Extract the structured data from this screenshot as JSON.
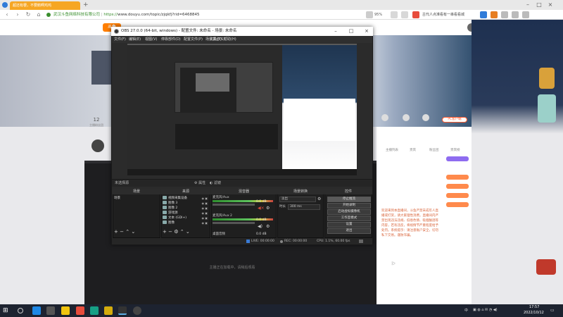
{
  "browser": {
    "tab_title": "超还有梗，不要鹅啊鸡鸡",
    "url_site": "武汉斗鱼网络科技有限公司",
    "url_scheme": "https://",
    "url_rest": "www.douyu.com/topic/zjqkfj?rid=6468845",
    "zoom": "95%",
    "search_text": "古代人点准看有一串看看城"
  },
  "site": {
    "logo": "斗鱼",
    "host_count": "12",
    "host_count_label": "主播粉丝团",
    "pc_button": "PC客户端",
    "tabs": [
      "主播列表",
      "贵宾",
      "粉丝团",
      "贵宾榜"
    ],
    "chat_lines": [
      "欢迎来到本直播间，斗鱼严禁未成年人直",
      "播或打赏，请大家理性消费。直播间内严",
      "禁出现违法违规、低俗色情、吸烟酗酒等",
      "内容，若有违反，将视情节严重程度给予",
      "处罚。系统提示：请注意账户安全，切勿",
      "私下交易。谨防诈骗。"
    ],
    "player_hint": "主播正在加载中，请稍后观看"
  },
  "obs": {
    "title": "OBS 27.0.0 (64-bit, windows) - 配置文件: 未命名 - 场景: 未命名",
    "menu": [
      "文件(F)",
      "编辑(E)",
      "视图(V)",
      "停靠部件(D)",
      "配置文件(P)",
      "场景集合(S)",
      "工具(T)",
      "帮助(H)"
    ],
    "no_source": "未选择源",
    "ctx_props": "属性",
    "ctx_filters": "滤镜",
    "docks": {
      "scenes": "场景",
      "sources": "来源",
      "mixer": "混音器",
      "transitions": "场景转换",
      "controls": "控件"
    },
    "scene_items": [
      "场景"
    ],
    "source_items": [
      "视频采集设备",
      "图像 3",
      "图像 2",
      "游戏源",
      "文本 (GDI+)",
      "图像"
    ],
    "mixer_tracks": [
      {
        "name": "麦克风/Aux",
        "db": "0.0 dB"
      },
      {
        "name": "麦克风/Aux 2",
        "db": "0.0 dB"
      },
      {
        "name": "桌面音频",
        "db": "0.0 dB"
      }
    ],
    "transition_type": "淡出",
    "transition_duration_label": "时长",
    "transition_duration": "300 ms",
    "controls": [
      "停止推流",
      "开始录制",
      "启动虚拟摄像机",
      "工作室模式",
      "设置",
      "退出"
    ],
    "status": {
      "live": "LIVE: 00:00:00",
      "rec": "REC: 00:00:00",
      "cpu": "CPU: 1.1%, 60.00 fps"
    }
  },
  "taskbar": {
    "time": "17:57",
    "date": "2022/10/12",
    "lang": "中"
  }
}
